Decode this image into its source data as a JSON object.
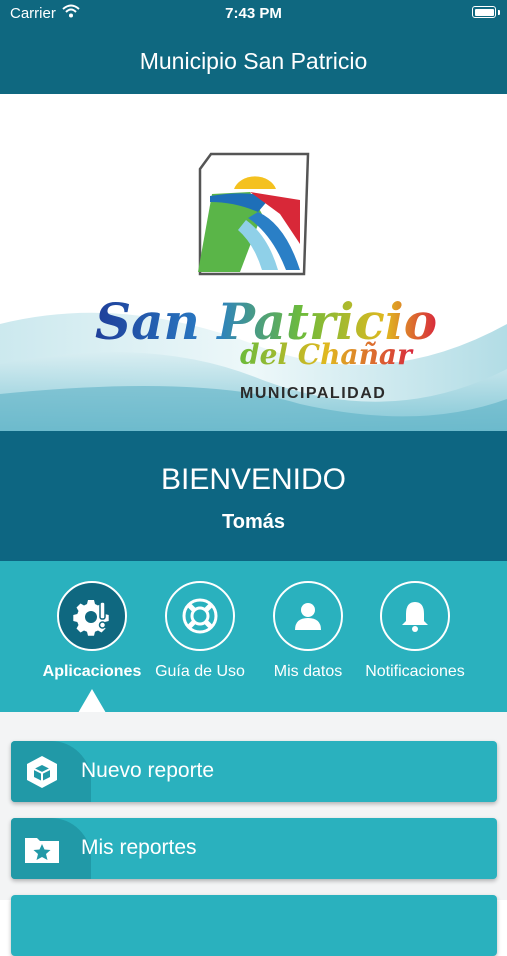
{
  "statusbar": {
    "carrier": "Carrier",
    "time": "7:43 PM"
  },
  "navbar": {
    "title": "Municipio San Patricio"
  },
  "banner": {
    "logo_line1": "San Patricio",
    "logo_line2": "del Chañar",
    "logo_sub": "MUNICIPALIDAD"
  },
  "welcome": {
    "title": "BIENVENIDO",
    "name": "Tomás"
  },
  "tabs": [
    {
      "label": "Aplicaciones",
      "icon": "gear-exclamation-icon",
      "active": true
    },
    {
      "label": "Guía de Uso",
      "icon": "lifebuoy-icon",
      "active": false
    },
    {
      "label": "Mis datos",
      "icon": "user-icon",
      "active": false
    },
    {
      "label": "Notificaciones",
      "icon": "bell-icon",
      "active": false
    }
  ],
  "menu": [
    {
      "label": "Nuevo reporte",
      "icon": "cube-icon"
    },
    {
      "label": "Mis reportes",
      "icon": "folder-star-icon"
    }
  ],
  "colors": {
    "primary": "#0f6880",
    "accent": "#2ab1be",
    "accent_dark": "#2199a7"
  }
}
